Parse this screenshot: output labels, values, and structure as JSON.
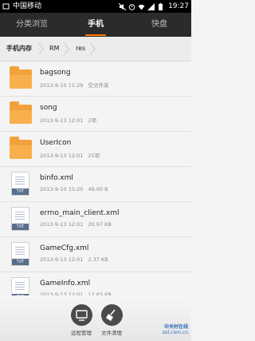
{
  "status_bar": {
    "carrier": "中国移动",
    "time": "19:27"
  },
  "tabs": [
    {
      "label": "分类浏览"
    },
    {
      "label": "手机"
    },
    {
      "label": "快盘"
    }
  ],
  "breadcrumb": [
    "手机内存",
    "RM",
    "res"
  ],
  "files": [
    {
      "name": "bagsong",
      "date": "2013-9-10 11:29",
      "info": "空文件夹",
      "type": "folder"
    },
    {
      "name": "song",
      "date": "2013-9-13 12:01",
      "info": "2项",
      "type": "folder"
    },
    {
      "name": "UserIcon",
      "date": "2013-9-13 12:01",
      "info": "25项",
      "type": "folder"
    },
    {
      "name": "binfo.xml",
      "date": "2013-9-10 15:20",
      "info": "49.00 B",
      "type": "txt"
    },
    {
      "name": "errno_main_client.xml",
      "date": "2013-9-13 12:01",
      "info": "20.97 KB",
      "type": "txt"
    },
    {
      "name": "GameCfg.xml",
      "date": "2013-9-13 12:01",
      "info": "2.37 KB",
      "type": "txt"
    },
    {
      "name": "GameInfo.xml",
      "date": "2013-9-13 12:01",
      "info": "12.83 KB",
      "type": "txt"
    }
  ],
  "file_tag": "TXT",
  "toolbar": {
    "remote_label": "远程管理",
    "cleanup_label": "文件清理"
  },
  "watermark": {
    "line1": "中关村在线",
    "line2": "zol.com.cn"
  },
  "colors": {
    "tab_bar": "#2b2b2b",
    "tab_indicator": "#ff7a00",
    "folder": "#f2a23a",
    "txt_tag": "#5a6e8c"
  }
}
